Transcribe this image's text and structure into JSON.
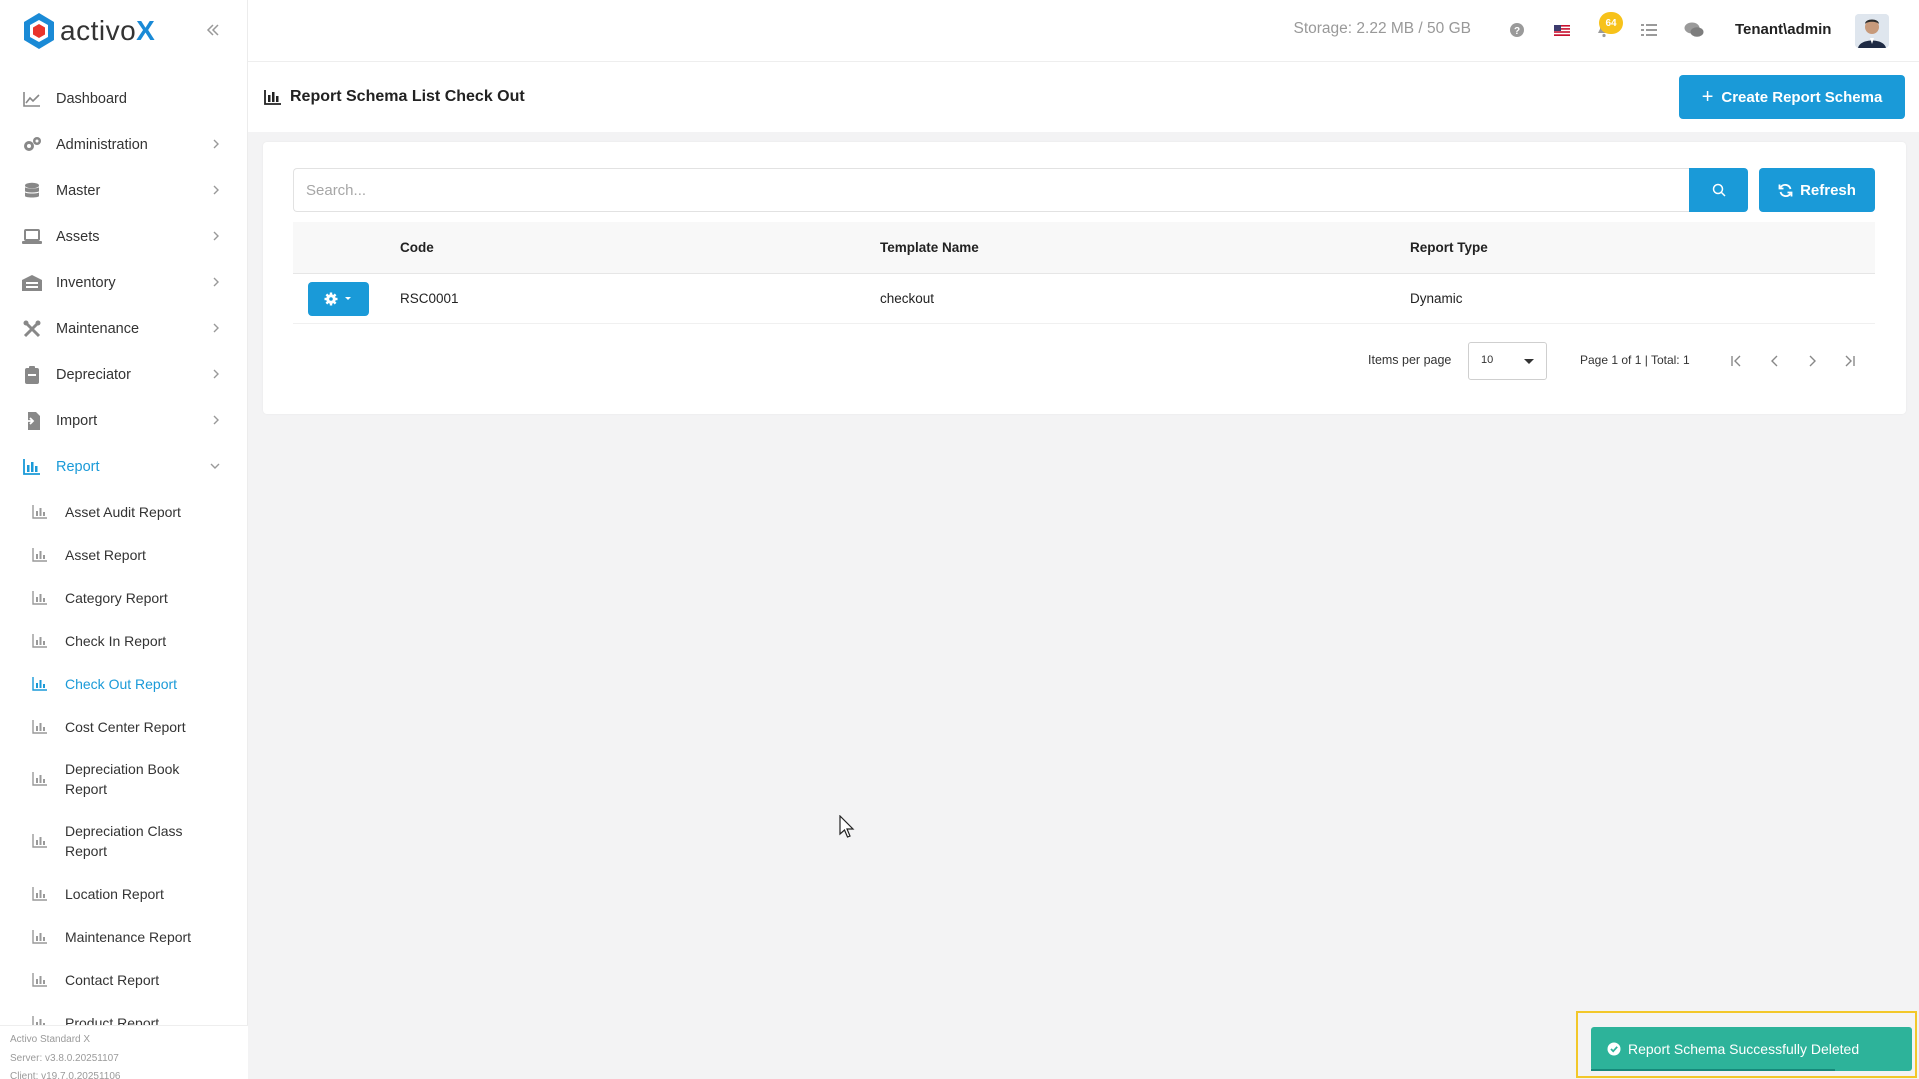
{
  "app": {
    "logo_text": "activo",
    "logo_accent": "X",
    "brand_color": "#1a9ad8"
  },
  "sidebar": {
    "collapse_icon": "double-chevron-left-icon",
    "items": [
      {
        "label": "Dashboard",
        "icon": "line-chart-icon",
        "has_children": false
      },
      {
        "label": "Administration",
        "icon": "gears-icon",
        "has_children": true
      },
      {
        "label": "Master",
        "icon": "database-icon",
        "has_children": true
      },
      {
        "label": "Assets",
        "icon": "laptop-icon",
        "has_children": true
      },
      {
        "label": "Inventory",
        "icon": "warehouse-icon",
        "has_children": true
      },
      {
        "label": "Maintenance",
        "icon": "tools-icon",
        "has_children": true
      },
      {
        "label": "Depreciator",
        "icon": "calculator-icon",
        "has_children": true
      },
      {
        "label": "Import",
        "icon": "file-import-icon",
        "has_children": true
      },
      {
        "label": "Report",
        "icon": "bar-chart-icon",
        "has_children": true,
        "expanded": true,
        "active": true
      }
    ],
    "report_children": [
      {
        "label": "Asset Audit Report"
      },
      {
        "label": "Asset Report"
      },
      {
        "label": "Category Report"
      },
      {
        "label": "Check In Report"
      },
      {
        "label": "Check Out Report",
        "active": true
      },
      {
        "label": "Cost Center Report"
      },
      {
        "label": "Depreciation Book Report"
      },
      {
        "label": "Depreciation Class Report"
      },
      {
        "label": "Location Report"
      },
      {
        "label": "Maintenance Report"
      },
      {
        "label": "Contact Report"
      },
      {
        "label": "Product Report"
      }
    ],
    "footer": {
      "edition": "Activo Standard X",
      "server": "Server: v3.8.0.20251107",
      "client": "Client: v19.7.0.20251106"
    }
  },
  "topbar": {
    "storage": "Storage: 2.22 MB / 50 GB",
    "notification_count": "64",
    "user": "Tenant\\admin",
    "icons": [
      "help-icon",
      "us-flag-icon",
      "bell-icon",
      "tasks-icon",
      "chat-icon"
    ]
  },
  "page": {
    "title": "Report Schema List Check Out",
    "create_button": "Create Report Schema"
  },
  "search": {
    "placeholder": "Search...",
    "value": ""
  },
  "refresh_button": "Refresh",
  "table": {
    "columns": [
      "",
      "Code",
      "Template Name",
      "Report Type"
    ],
    "rows": [
      {
        "code": "RSC0001",
        "template_name": "checkout",
        "report_type": "Dynamic"
      }
    ]
  },
  "pagination": {
    "items_per_page_label": "Items per page",
    "items_per_page": "10",
    "page_info": "Page 1 of 1 | Total: 1"
  },
  "toast": {
    "message": "Report Schema Successfully Deleted",
    "color": "#2db39a"
  }
}
